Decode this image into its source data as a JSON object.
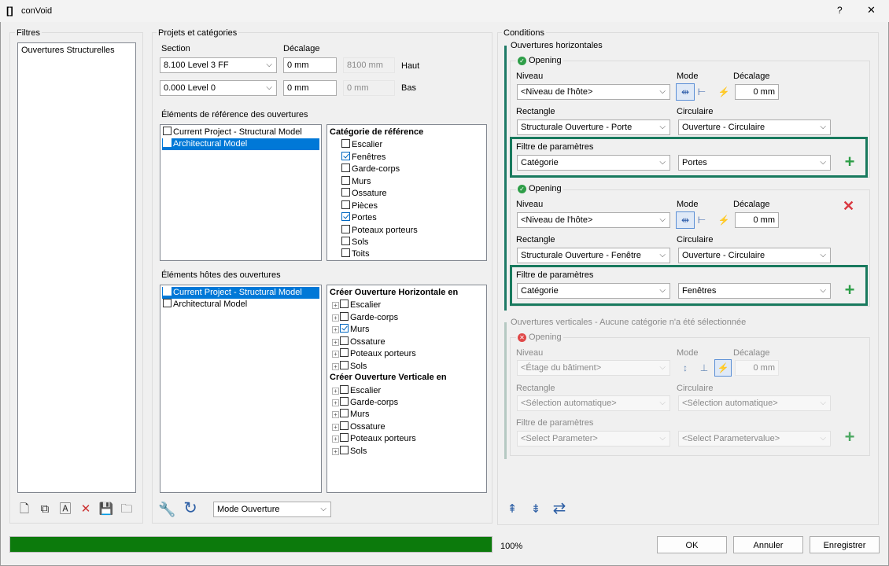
{
  "window": {
    "title": "conVoid",
    "help": "?",
    "close": "✕"
  },
  "filters": {
    "title": "Filtres",
    "items": [
      "Ouvertures Structurelles"
    ]
  },
  "projects": {
    "title": "Projets et catégories",
    "section_label": "Section",
    "offset_label": "Décalage",
    "top": {
      "level": "8.100  Level 3 FF",
      "offset": "0 mm",
      "computed": "8100 mm",
      "label": "Haut"
    },
    "bottom": {
      "level": "0.000  Level 0",
      "offset": "0 mm",
      "computed": "0 mm",
      "label": "Bas"
    },
    "ref_title": "Éléments de référence des ouvertures",
    "ref_models": [
      "Current Project - Structural Model",
      "Architectural Model"
    ],
    "ref_cat_title": "Catégorie de référence",
    "ref_cats": [
      "Escalier",
      "Fenêtres",
      "Garde-corps",
      "Murs",
      "Ossature",
      "Pièces",
      "Portes",
      "Poteaux porteurs",
      "Sols",
      "Toits"
    ],
    "host_title": "Éléments hôtes des ouvertures",
    "host_models": [
      "Current Project - Structural Model",
      "Architectural Model"
    ],
    "host_h_title": "Créer Ouverture Horizontale en",
    "host_h_cats": [
      "Escalier",
      "Garde-corps",
      "Murs",
      "Ossature",
      "Poteaux porteurs",
      "Sols"
    ],
    "host_v_title": "Créer Ouverture Verticale en",
    "host_v_cats": [
      "Escalier",
      "Garde-corps",
      "Murs",
      "Ossature",
      "Poteaux porteurs",
      "Sols"
    ],
    "mode_select": "Mode Ouverture"
  },
  "conditions": {
    "title": "Conditions",
    "horizontal_title": "Ouvertures horizontales",
    "openings": [
      {
        "title": "Opening",
        "niveau_label": "Niveau",
        "mode_label": "Mode",
        "offset_label": "Décalage",
        "niveau": "<Niveau de l'hôte>",
        "offset": "0 mm",
        "rect_label": "Rectangle",
        "circ_label": "Circulaire",
        "rect": "Structurale Ouverture - Porte",
        "circ": "Ouverture - Circulaire",
        "filter_label": "Filtre de paramètres",
        "param": "Catégorie",
        "value": "Portes"
      },
      {
        "title": "Opening",
        "niveau_label": "Niveau",
        "mode_label": "Mode",
        "offset_label": "Décalage",
        "niveau": "<Niveau de l'hôte>",
        "offset": "0 mm",
        "rect_label": "Rectangle",
        "circ_label": "Circulaire",
        "rect": "Structurale Ouverture - Fenêtre",
        "circ": "Ouverture - Circulaire",
        "filter_label": "Filtre de paramètres",
        "param": "Catégorie",
        "value": "Fenêtres"
      }
    ],
    "vertical_title": "Ouvertures verticales - Aucune catégorie n'a été sélectionnée",
    "vertical": {
      "title": "Opening",
      "niveau_label": "Niveau",
      "mode_label": "Mode",
      "offset_label": "Décalage",
      "niveau": "<Étage du bâtiment>",
      "offset": "0 mm",
      "rect_label": "Rectangle",
      "circ_label": "Circulaire",
      "rect": "<Sélection automatique>",
      "circ": "<Sélection automatique>",
      "filter_label": "Filtre de paramètres",
      "param": "<Select Parameter>",
      "value": "<Select Parametervalue>"
    }
  },
  "footer": {
    "progress": 1.0,
    "progress_text": "100%",
    "ok": "OK",
    "cancel": "Annuler",
    "save": "Enregistrer"
  },
  "colors": {
    "accent": "#0078d7",
    "progress": "#0c7a0c",
    "highlight": "#197a5e",
    "plus": "#2e9e48",
    "remove": "#d9363e"
  }
}
